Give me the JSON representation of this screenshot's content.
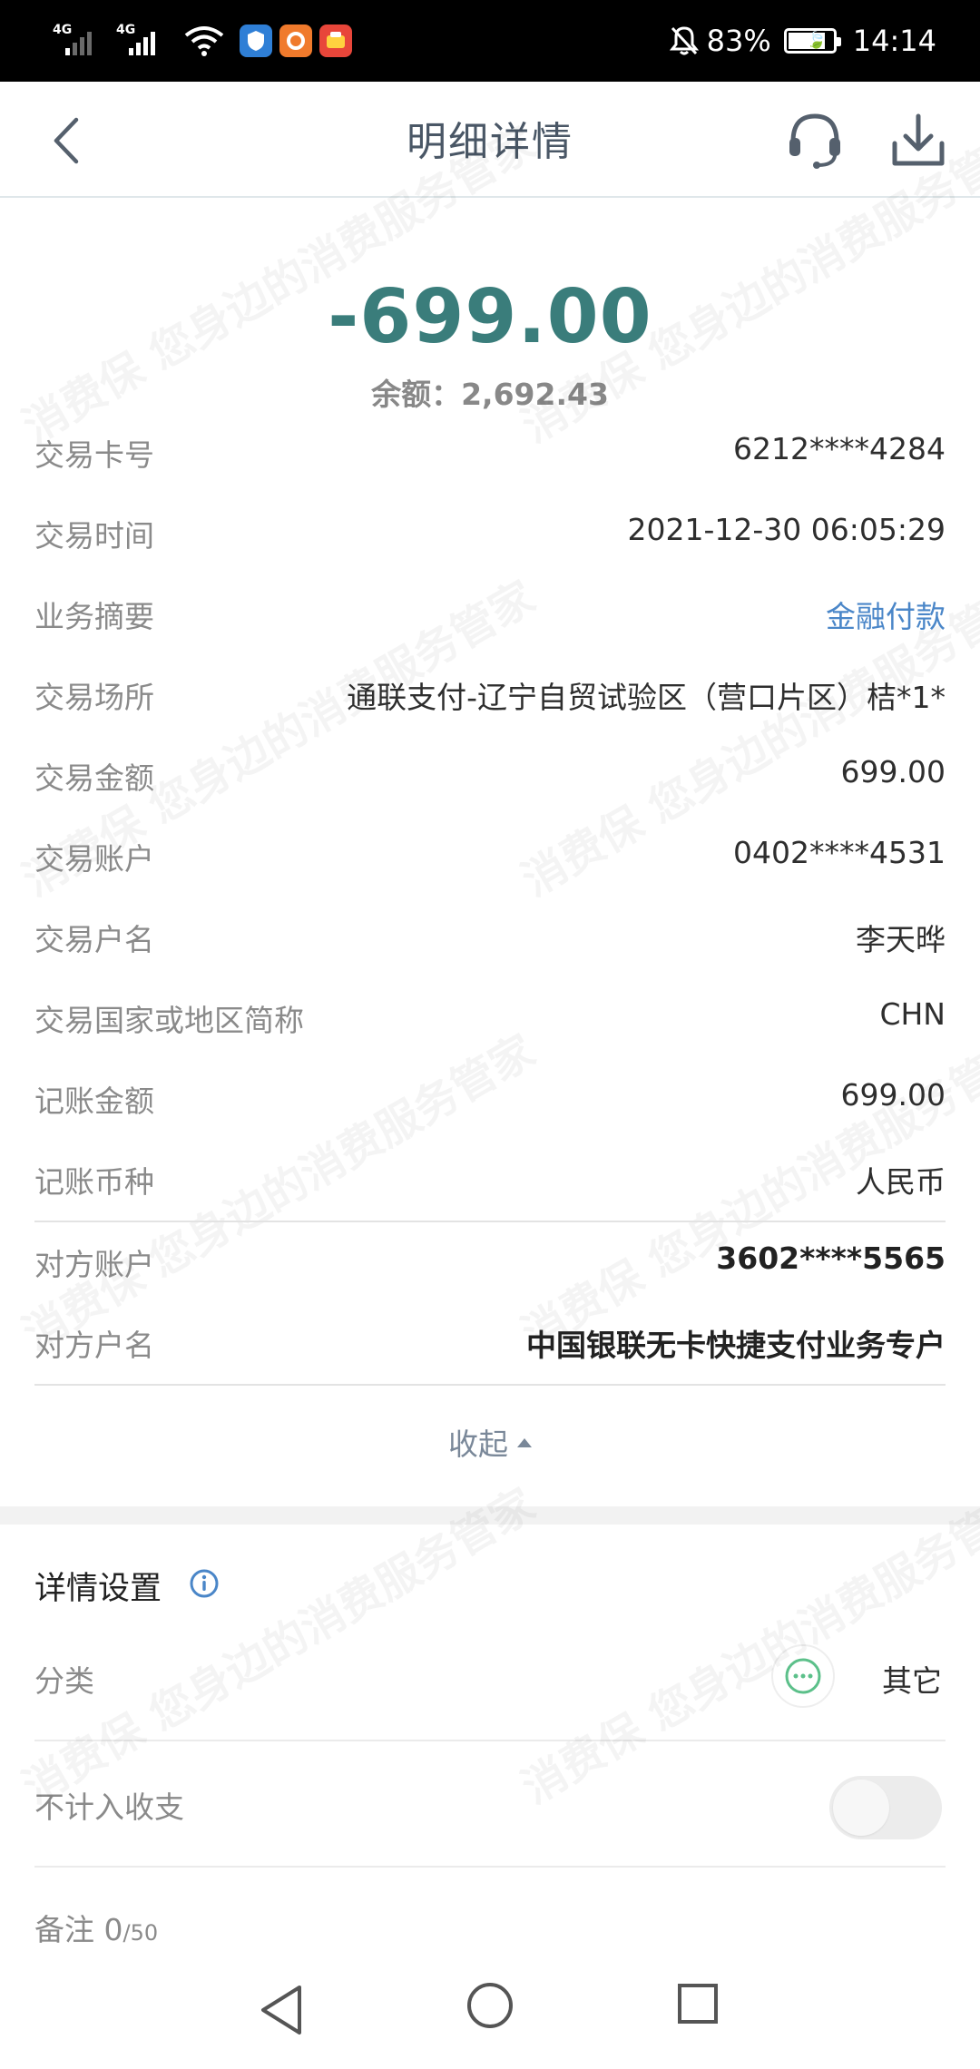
{
  "status_bar": {
    "network_1": "4G",
    "network_2": "4G",
    "battery_percent": "83%",
    "battery_level": 0.83,
    "time": "14:14"
  },
  "header": {
    "title": "明细详情",
    "icons": [
      "back-arrow-icon",
      "customer-service-icon",
      "download-icon"
    ]
  },
  "watermark": {
    "text": "消费保 您身边的消费服务管家"
  },
  "summary": {
    "amount": "-699.00",
    "balance": "余额：2,692.43",
    "amount_color": "#3a7d7b"
  },
  "details": [
    {
      "label": "交易卡号",
      "value": "6212****4284"
    },
    {
      "label": "交易时间",
      "value": "2021-12-30 06:05:29"
    },
    {
      "label": "业务摘要",
      "value": "金融付款"
    },
    {
      "label": "交易场所",
      "value": "通联支付-辽宁自贸试验区（营口片区）桔*1*"
    },
    {
      "label": "交易金额",
      "value": "699.00"
    },
    {
      "label": "交易账户",
      "value": "0402****4531"
    },
    {
      "label": "交易户名",
      "value": "李天晔"
    },
    {
      "label": "交易国家或地区简称",
      "value": "CHN"
    },
    {
      "label": "记账金额",
      "value": "699.00"
    },
    {
      "label": "记账币种",
      "value": "人民币"
    }
  ],
  "counterparty": [
    {
      "label": "对方账户",
      "value": "3602****5565"
    },
    {
      "label": "对方户名",
      "value": "中国银联无卡快捷支付业务专户"
    }
  ],
  "collapse_label": "收起",
  "settings": {
    "title": "详情设置",
    "category_label": "分类",
    "category_value": "其它",
    "exclude_label": "不计入收支",
    "exclude_enabled": false,
    "note_label": "备注",
    "note_count": "0",
    "note_max": "/50"
  },
  "colors": {
    "accent_teal": "#3a7d7b",
    "link_blue": "#4a86c8",
    "category_green": "#5cc08a"
  }
}
